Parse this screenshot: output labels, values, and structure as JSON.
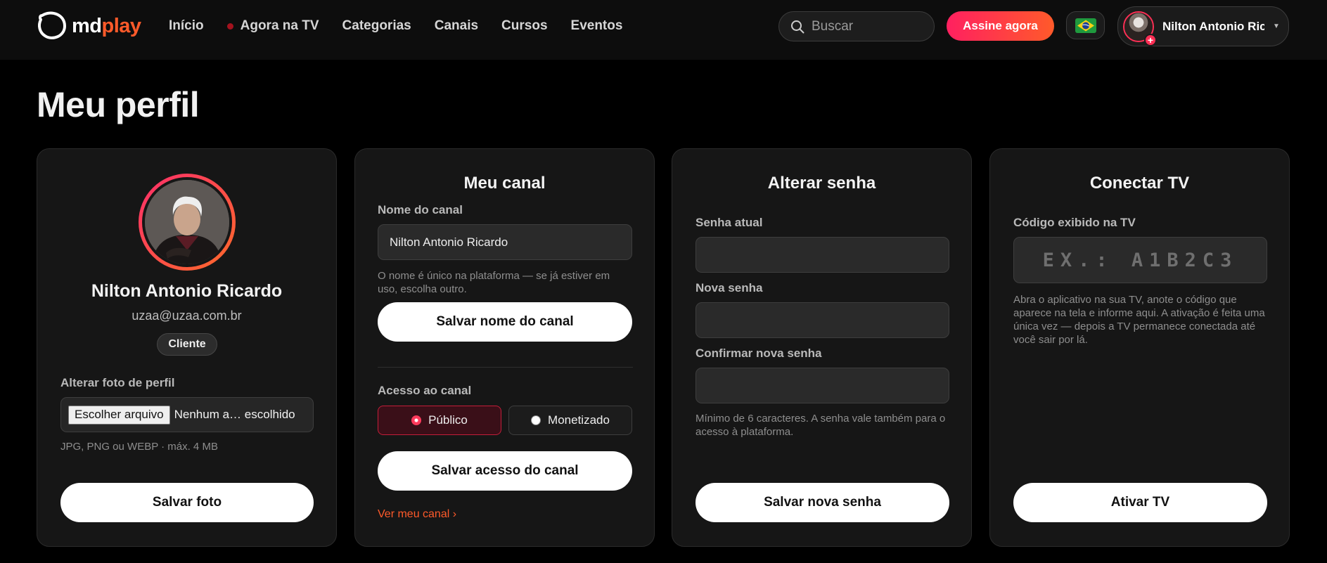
{
  "header": {
    "logo_part1": "md",
    "logo_part2": "play",
    "nav": [
      {
        "label": "Início"
      },
      {
        "label": "Agora na TV"
      },
      {
        "label": "Categorias"
      },
      {
        "label": "Canais"
      },
      {
        "label": "Cursos"
      },
      {
        "label": "Eventos"
      }
    ],
    "search_placeholder": "Buscar",
    "subscribe_label": "Assine agora",
    "user_name": "Nilton Antonio Ric",
    "avatar_badge": "+"
  },
  "page_title": "Meu perfil",
  "profile_card": {
    "name": "Nilton Antonio Ricardo",
    "email": "uzaa@uzaa.com.br",
    "role": "Cliente",
    "photo_label": "Alterar foto de perfil",
    "file_button": "Escolher arquivo",
    "file_status": "Nenhum a… escolhido",
    "file_hint": "JPG, PNG ou WEBP · máx. 4 MB",
    "save_label": "Salvar foto"
  },
  "channel_card": {
    "title": "Meu canal",
    "name_label": "Nome do canal",
    "name_value": "Nilton Antonio Ricardo",
    "name_hint": "O nome é único na plataforma — se já estiver em uso, escolha outro.",
    "save_name_label": "Salvar nome do canal",
    "access_label": "Acesso ao canal",
    "access_options": [
      {
        "label": "Público",
        "selected": true
      },
      {
        "label": "Monetizado",
        "selected": false
      }
    ],
    "save_access_label": "Salvar acesso do canal",
    "view_link": "Ver meu canal ›"
  },
  "password_card": {
    "title": "Alterar senha",
    "current_label": "Senha atual",
    "new_label": "Nova senha",
    "confirm_label": "Confirmar nova senha",
    "hint": "Mínimo de 6 caracteres. A senha vale também para o acesso à plataforma.",
    "save_label": "Salvar nova senha"
  },
  "tv_card": {
    "title": "Conectar TV",
    "code_label": "Código exibido na TV",
    "code_placeholder": "EX.: A1B2C3",
    "hint": "Abra o aplicativo na sua TV, anote o código que aparece na tela e informe aqui. A ativação é feita uma única vez — depois a TV permanece conectada até você sair por lá.",
    "activate_label": "Ativar TV"
  },
  "colors": {
    "accent": "#ff2f55",
    "accent_orange": "#ff5a2a",
    "background": "#000000",
    "card": "#161616"
  }
}
